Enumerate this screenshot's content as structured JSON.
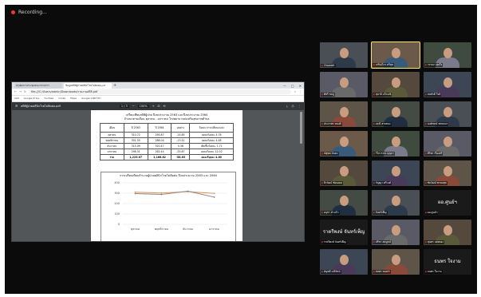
{
  "recording": {
    "label": "Recording..."
  },
  "browser": {
    "tabs": [
      {
        "label": "สรุปผลการประชุมคณะกรรมการ"
      },
      {
        "label": "ข้อมูลสถิติผู้ป่วยคลินิกโรคไม่ติดต่อ.pdf"
      }
    ],
    "tab_plus": "+",
    "window_controls": [
      "—",
      "▢",
      "✕"
    ],
    "url": "file:///C:/Users/admin/Downloads/รายงานสถิติ.pdf",
    "bookmarks": [
      "แอป",
      "Google Drive",
      "YouTube",
      "Gmail",
      "Maps",
      "Google แปลภาษา"
    ]
  },
  "pdf": {
    "filename": "สถิติผู้ป่วยคลินิกโรคไม่ติดต่อ.pdf",
    "page": "1 / 3",
    "zoom": "100%",
    "doc_title": [
      "เปรียบเทียบสถิติผู้ป่วย ปีงบประมาณ 2563 และปีงบประมาณ 2564",
      "จำแนกตามเดือน ตุลาคม - มกราคม โรงพยาบาลส่งเสริมสุขภาพตำบล"
    ],
    "table": {
      "headers": [
        "เดือน",
        "ปี 2563",
        "ปี 2564",
        "ผลต่าง",
        "ร้อยละการเปลี่ยนแปลง"
      ],
      "rows": [
        [
          "ตุลาคม",
          "310.72",
          "295.87",
          "-14.85",
          "ลดลงร้อยละ 4.78"
        ],
        [
          "พฤศจิกายน",
          "301.55",
          "288.04",
          "-13.51",
          "ลดลงร้อยละ 4.48"
        ],
        [
          "ธันวาคม",
          "315.09",
          "320.47",
          "5.38",
          "เพิ่มขึ้นร้อยละ 1.71"
        ],
        [
          "มกราคม",
          "298.31",
          "262.44",
          "-35.87",
          "ลดลงร้อยละ 12.02"
        ]
      ],
      "total": [
        "รวม",
        "1,225.67",
        "1,166.82",
        "-58.85",
        "ลดลงร้อยละ 4.80"
      ]
    }
  },
  "chart_data": {
    "type": "line",
    "title": "การเปรียบเทียบจำนวนผู้ป่วยคลินิกโรคไม่ติดต่อ ปีงบประมาณ 2563 และ 2564",
    "categories": [
      "ตุลาคม",
      "พฤศจิกายน",
      "ธันวาคม",
      "มกราคม"
    ],
    "series": [
      {
        "values": [
          310,
          302,
          315,
          298
        ]
      },
      {
        "values": [
          296,
          288,
          320,
          262
        ]
      }
    ],
    "ylim": [
      0,
      400
    ],
    "yticks": [
      "400",
      "300",
      "200",
      "100",
      "0"
    ],
    "grid": true,
    "colors": [
      "#e8914a",
      "#8a8a8a"
    ]
  },
  "participants": [
    {
      "name": "Chawalit"
    },
    {
      "name": "เกรียงไกร ศรีสุข",
      "speaking": true
    },
    {
      "name": "วรรณา สุขใจ"
    },
    {
      "name": "พัชรี ชมภู"
    },
    {
      "name": "สุมาลี แก้วมณี"
    },
    {
      "name": "สมศักดิ์ ใจดี"
    },
    {
      "name": "ประภาพร ทองดี"
    },
    {
      "name": "อรุณี สายทอง"
    },
    {
      "name": "นงลักษณ์ พรหมมา"
    },
    {
      "name": "ณัฐพล มั่นคง"
    },
    {
      "name": "วิไลวรรณ บุญมา"
    },
    {
      "name": "ศิริพร เรืองศรี"
    },
    {
      "name": "ธีรวัฒน์ ชัยมงคล"
    },
    {
      "name": "กัญญา ศรีวงศ์"
    },
    {
      "name": "ชัยวัฒน์ พรหมสุข"
    },
    {
      "name": "อนุชา คำแก้ว"
    },
    {
      "name": "จันทร์เพ็ญ"
    },
    {
      "name": "ผอ.ศูนย์ฯ",
      "big_text": "ผอ.ศูนย์ฯ"
    },
    {
      "name": "ราตรีพงษ์ จันทร์เพ็ญ",
      "big_text": "ราตรีพงษ์ จันทร์เพ็ญ"
    },
    {
      "name": "ปรีชา สมบูรณ์"
    },
    {
      "name": "สุนทร แสงทอง"
    },
    {
      "name": "อัญชลี มณีรัตน์"
    },
    {
      "name": "สมพร ทองคำ"
    },
    {
      "name": "ธนพร ใจงาม",
      "big_text": "ธนพร ใจงาม"
    }
  ]
}
